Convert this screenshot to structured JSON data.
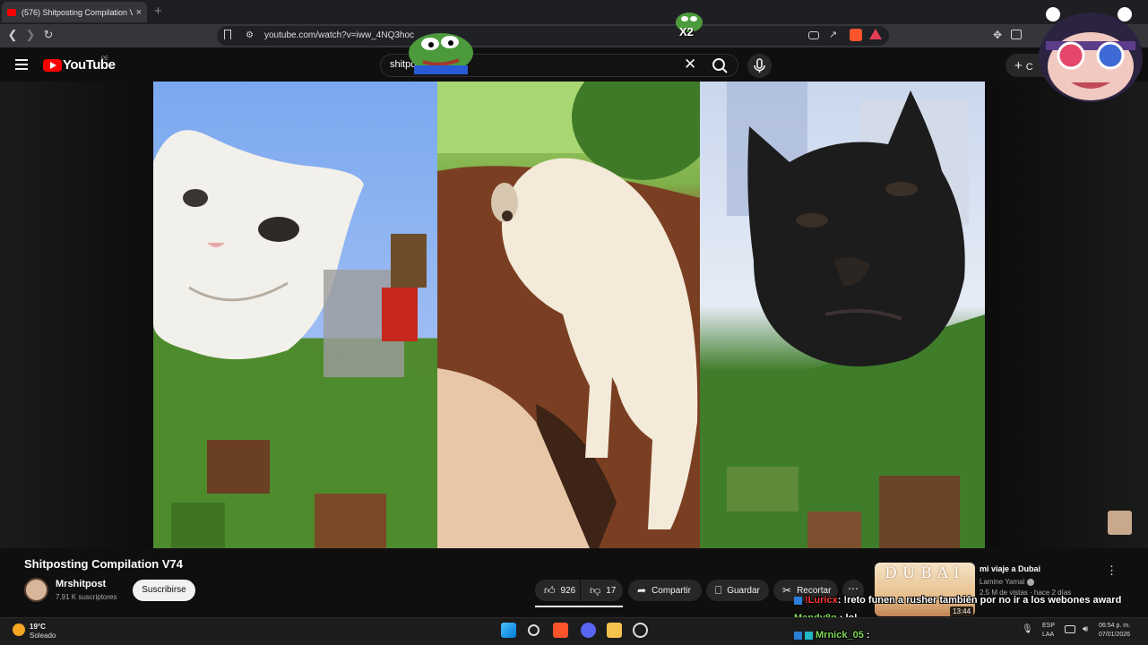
{
  "browser": {
    "tab_title": "(576) Shitposting Compilation V",
    "url": "youtube.com/watch?v=iww_4NQ3hoc"
  },
  "youtube": {
    "logo_text": "YouTube",
    "country_code": "PE",
    "search_value": "shitpost",
    "create_label": "C"
  },
  "video": {
    "title": "Shitposting Compilation V74",
    "channel_name": "Mrshitpost",
    "subscribers": "7.91 K suscriptores",
    "subscribe_label": "Suscribirse",
    "likes": "926",
    "dislikes": "17",
    "share_label": "Compartir",
    "save_label": "Guardar",
    "clip_label": "Recortar",
    "more_label": "⋯"
  },
  "recommended": {
    "thumb_text": "DUBAI",
    "title": "mi viaje a Dubai",
    "channel": "Lamine Yamal",
    "meta": "2.5 M de vistas · hace 2 días",
    "duration": "13:44"
  },
  "chat": [
    {
      "user": "!Luricx",
      "text": ": !reto funen a rusher también por no ir a los webones award",
      "color": "#ff3b3b"
    },
    {
      "user": "Mandy8g",
      "text": ": lol",
      "color": "#7ed957"
    },
    {
      "user": "Mrnick_05",
      "text": ":",
      "color": "#7ed957"
    }
  ],
  "overlay": {
    "emote_multiplier": "X2"
  },
  "taskbar": {
    "temperature": "19°C",
    "condition": "Soleado",
    "lang_1": "ESP",
    "lang_2": "LAA",
    "time": "06:54 p. m.",
    "date": "07/01/2026"
  },
  "colors": {
    "youtube_red": "#ff0000",
    "background": "#0f0f0f",
    "pill": "#272727"
  }
}
